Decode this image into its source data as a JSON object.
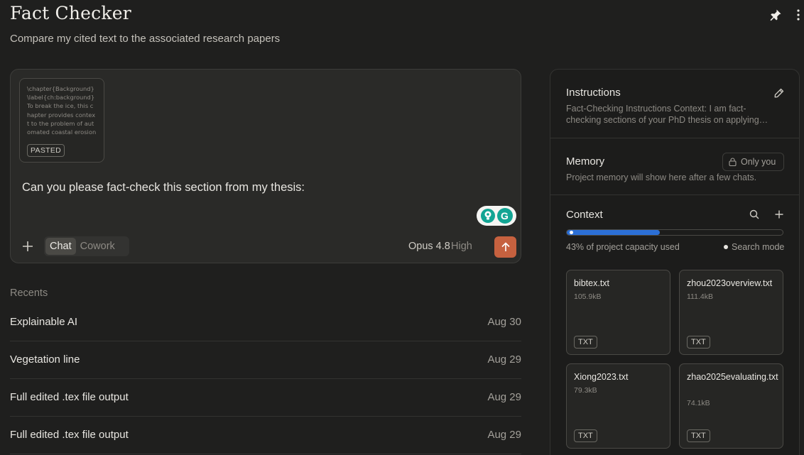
{
  "header": {
    "title": "Fact Checker",
    "subtitle": "Compare my cited text to the associated research papers"
  },
  "composer": {
    "pasted_preview": "\\chapter{Background}\\label{ch:background} To break the ice, this chapter provides context to the problem of automated coastal erosion monitoring. At ...",
    "pasted_badge": "PASTED",
    "prompt": "Can you please fact-check this section from my thesis:",
    "modes": [
      "Chat",
      "Cowork"
    ],
    "active_mode": "Chat",
    "model": "Opus 4.8",
    "effort": "High"
  },
  "recents": {
    "label": "Recents",
    "items": [
      {
        "title": "Explainable AI",
        "date": "Aug 30"
      },
      {
        "title": "Vegetation line",
        "date": "Aug 29"
      },
      {
        "title": "Full edited .tex file output",
        "date": "Aug 29"
      },
      {
        "title": "Full edited .tex file output",
        "date": "Aug 29"
      }
    ]
  },
  "panel": {
    "instructions": {
      "title": "Instructions",
      "text": "Fact-Checking Instructions Context: I am fact-checking sections of your PhD thesis on applying…"
    },
    "memory": {
      "title": "Memory",
      "badge": "Only you",
      "text": "Project memory will show here after a few chats."
    },
    "context": {
      "title": "Context",
      "capacity_percent": 43,
      "capacity_text": "43% of project capacity used",
      "search_mode": "Search mode",
      "files": [
        {
          "name": "bibtex.txt",
          "size": "105.9kB",
          "type": "TXT"
        },
        {
          "name": "zhou2023overview.txt",
          "size": "111.4kB",
          "type": "TXT"
        },
        {
          "name": "Xiong2023.txt",
          "size": "79.3kB",
          "type": "TXT"
        },
        {
          "name": "zhao2025evaluating.txt",
          "size": "74.1kB",
          "type": "TXT"
        }
      ]
    }
  },
  "colors": {
    "background": "#1f1f1e",
    "send_button": "#c6613f",
    "capacity_bar": "#2b6fd6",
    "grammarly": "#12a594"
  },
  "icons": [
    "pin-icon",
    "more-vertical-icon",
    "plus-icon",
    "arrow-up-icon",
    "grammarly-bulb-icon",
    "grammarly-logo-icon",
    "pencil-icon",
    "lock-icon",
    "search-icon"
  ]
}
